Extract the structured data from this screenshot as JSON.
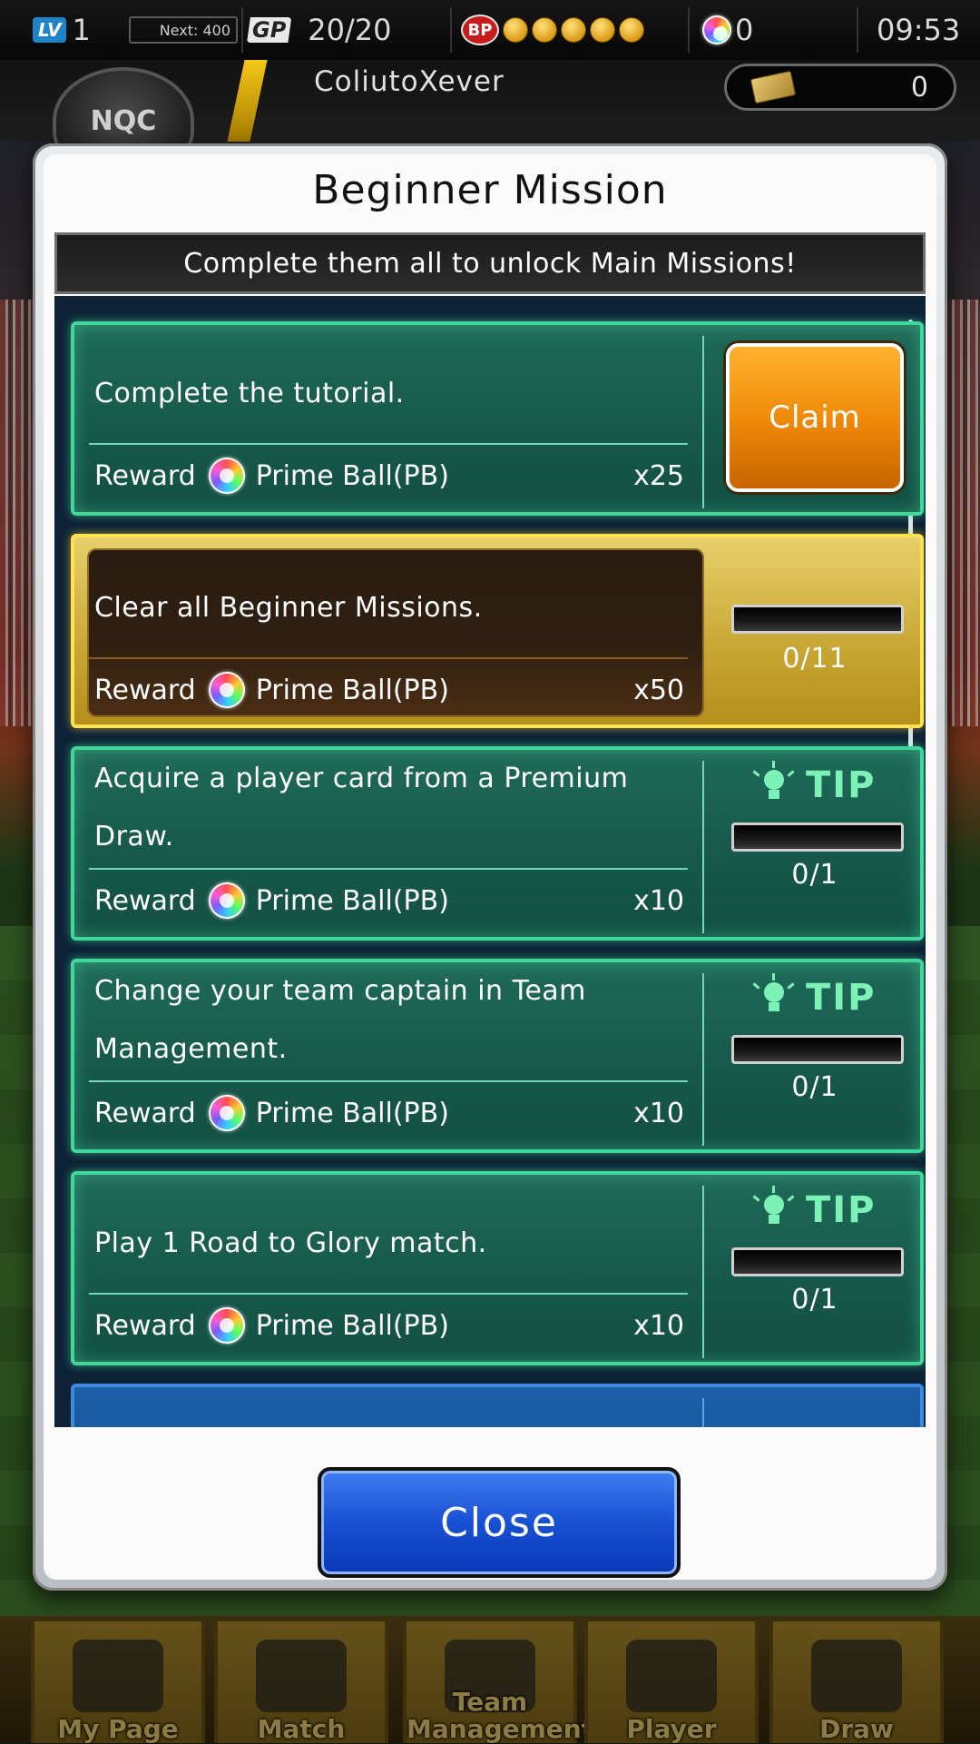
{
  "status_bar": {
    "level_badge": "LV",
    "level": "1",
    "next_exp": "Next: 400",
    "gp_badge": "GP",
    "gp": "20/20",
    "bp_badge": "BP",
    "bp_coins": 5,
    "prime_balls": "0",
    "time": "09:53"
  },
  "header": {
    "club_logo_text": "NQC",
    "username": "ColiutoXever",
    "ticket_count": "0"
  },
  "modal": {
    "title": "Beginner Mission",
    "subtitle": "Complete them all to unlock Main Missions!",
    "reward_label": "Reward",
    "reward_item": "Prime Ball(PB)",
    "tip_label": "TIP",
    "claim_label": "Claim",
    "close_label": "Close",
    "missions": [
      {
        "description": "Complete the tutorial.",
        "quantity": "x25",
        "state": "claim"
      },
      {
        "description": "Clear all Beginner Missions.",
        "quantity": "x50",
        "progress": "0/11",
        "progress_value": 0
      },
      {
        "description": "Acquire a player card from a Premium Draw.",
        "quantity": "x10",
        "progress": "0/1",
        "progress_value": 0
      },
      {
        "description": "Change your team captain in Team Management.",
        "quantity": "x10",
        "progress": "0/1",
        "progress_value": 0
      },
      {
        "description": "Play 1 Road to Glory match.",
        "quantity": "x10",
        "progress": "0/1",
        "progress_value": 0
      }
    ]
  },
  "bottom_nav": [
    {
      "label": "My Page",
      "icon": "shield-icon"
    },
    {
      "label": "Match",
      "icon": "stadium-icon"
    },
    {
      "label": "Team Management",
      "icon": "formation-icon"
    },
    {
      "label": "Player",
      "icon": "players-icon"
    },
    {
      "label": "Draw",
      "icon": "cards-icon"
    }
  ],
  "colors": {
    "mission_green": "#17594a",
    "mission_gold": "#c8a533",
    "claim_orange": "#f08a0a",
    "close_blue": "#1850d3",
    "tip_green": "#7cf2b6"
  }
}
